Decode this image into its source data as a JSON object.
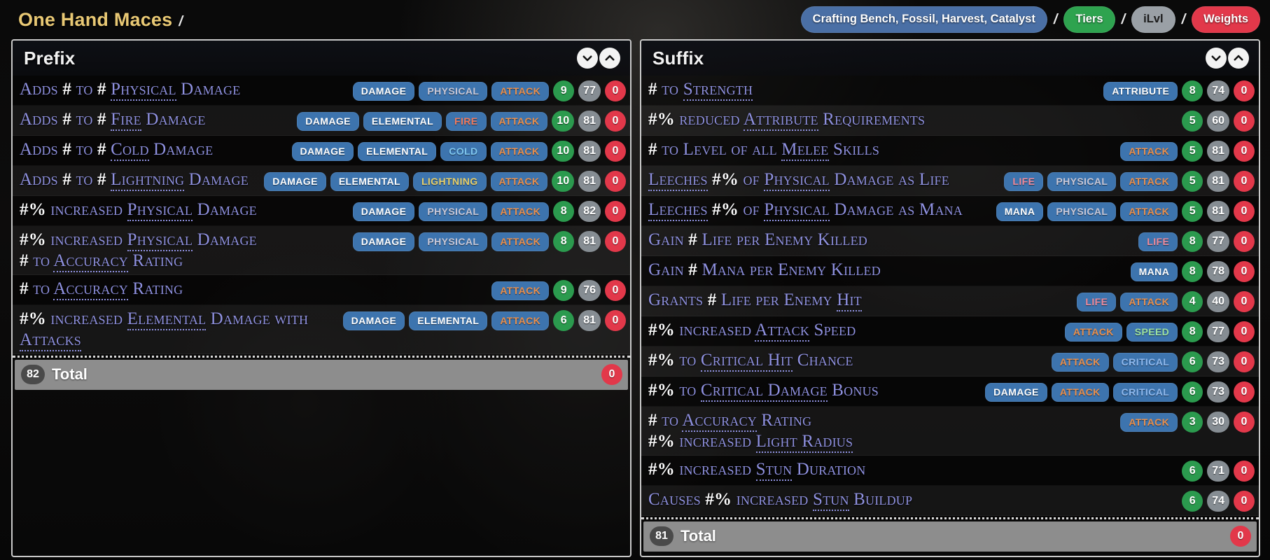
{
  "header": {
    "title": "One Hand Maces",
    "separator": "/",
    "nav": [
      {
        "label": "Crafting Bench, Fossil, Harvest, Catalyst",
        "color": "#4a6fa5",
        "style": "pill-blue"
      },
      {
        "label": "Tiers",
        "color": "#2ea34f",
        "style": "pill-green"
      },
      {
        "label": "iLvl",
        "color": "#9aa0a6",
        "style": "pill-gray"
      },
      {
        "label": "Weights",
        "color": "#e2384a",
        "style": "pill-red"
      }
    ]
  },
  "icons": {
    "collapse_all": "chevron-down-icon",
    "expand_all": "chevron-up-icon"
  },
  "prefix": {
    "title": "Prefix",
    "total_label": "Total",
    "total_count": "82",
    "total_weight": "0",
    "rows": [
      {
        "text_parts": [
          {
            "t": "Adds ",
            "k": false
          },
          {
            "t": "#",
            "k": "num"
          },
          {
            "t": " to ",
            "k": false
          },
          {
            "t": "#",
            "k": "num"
          },
          {
            "t": " ",
            "k": false
          },
          {
            "t": "Physical",
            "k": true
          },
          {
            "t": " Damage",
            "k": false
          }
        ],
        "plain_text": "Adds # to # Physical Damage",
        "tags": [
          {
            "label": "DAMAGE",
            "cls": "t-damage"
          },
          {
            "label": "PHYSICAL",
            "cls": "t-physical"
          },
          {
            "label": "ATTACK",
            "cls": "t-attack"
          }
        ],
        "tier": "9",
        "ilvl": "77",
        "weight": "0"
      },
      {
        "text_parts": [
          {
            "t": "Adds ",
            "k": false
          },
          {
            "t": "#",
            "k": "num"
          },
          {
            "t": " to ",
            "k": false
          },
          {
            "t": "#",
            "k": "num"
          },
          {
            "t": " ",
            "k": false
          },
          {
            "t": "Fire",
            "k": true
          },
          {
            "t": " Damage",
            "k": false
          }
        ],
        "plain_text": "Adds # to # Fire Damage",
        "tags": [
          {
            "label": "DAMAGE",
            "cls": "t-damage"
          },
          {
            "label": "ELEMENTAL",
            "cls": "t-elemental"
          },
          {
            "label": "FIRE",
            "cls": "t-fire"
          },
          {
            "label": "ATTACK",
            "cls": "t-attack"
          }
        ],
        "tier": "10",
        "ilvl": "81",
        "weight": "0"
      },
      {
        "text_parts": [
          {
            "t": "Adds ",
            "k": false
          },
          {
            "t": "#",
            "k": "num"
          },
          {
            "t": " to ",
            "k": false
          },
          {
            "t": "#",
            "k": "num"
          },
          {
            "t": " ",
            "k": false
          },
          {
            "t": "Cold",
            "k": true
          },
          {
            "t": " Damage",
            "k": false
          }
        ],
        "plain_text": "Adds # to # Cold Damage",
        "tags": [
          {
            "label": "DAMAGE",
            "cls": "t-damage"
          },
          {
            "label": "ELEMENTAL",
            "cls": "t-elemental"
          },
          {
            "label": "COLD",
            "cls": "t-cold"
          },
          {
            "label": "ATTACK",
            "cls": "t-attack"
          }
        ],
        "tier": "10",
        "ilvl": "81",
        "weight": "0"
      },
      {
        "text_parts": [
          {
            "t": "Adds ",
            "k": false
          },
          {
            "t": "#",
            "k": "num"
          },
          {
            "t": " to ",
            "k": false
          },
          {
            "t": "#",
            "k": "num"
          },
          {
            "t": " ",
            "k": false
          },
          {
            "t": "Lightning",
            "k": true
          },
          {
            "t": " Damage",
            "k": false
          }
        ],
        "plain_text": "Adds # to # Lightning Damage",
        "tags": [
          {
            "label": "DAMAGE",
            "cls": "t-damage"
          },
          {
            "label": "ELEMENTAL",
            "cls": "t-elemental"
          },
          {
            "label": "LIGHTNING",
            "cls": "t-lightning"
          },
          {
            "label": "ATTACK",
            "cls": "t-attack"
          }
        ],
        "tier": "10",
        "ilvl": "81",
        "weight": "0"
      },
      {
        "text_parts": [
          {
            "t": "#%",
            "k": "num"
          },
          {
            "t": " increased ",
            "k": false
          },
          {
            "t": "Physical",
            "k": true
          },
          {
            "t": " Damage",
            "k": false
          }
        ],
        "plain_text": "#% increased Physical Damage",
        "tags": [
          {
            "label": "DAMAGE",
            "cls": "t-damage"
          },
          {
            "label": "PHYSICAL",
            "cls": "t-physical"
          },
          {
            "label": "ATTACK",
            "cls": "t-attack"
          }
        ],
        "tier": "8",
        "ilvl": "82",
        "weight": "0"
      },
      {
        "text_parts": [
          {
            "t": "#%",
            "k": "num"
          },
          {
            "t": " increased ",
            "k": false
          },
          {
            "t": "Physical",
            "k": true
          },
          {
            "t": " Damage",
            "k": false
          },
          {
            "t": "\n",
            "k": "br"
          },
          {
            "t": "#",
            "k": "num"
          },
          {
            "t": " to ",
            "k": false
          },
          {
            "t": "Accuracy",
            "k": true
          },
          {
            "t": " Rating",
            "k": false
          }
        ],
        "plain_text": "#% increased Physical Damage # to Accuracy Rating",
        "tags": [
          {
            "label": "DAMAGE",
            "cls": "t-damage"
          },
          {
            "label": "PHYSICAL",
            "cls": "t-physical"
          },
          {
            "label": "ATTACK",
            "cls": "t-attack"
          }
        ],
        "tier": "8",
        "ilvl": "81",
        "weight": "0"
      },
      {
        "text_parts": [
          {
            "t": "#",
            "k": "num"
          },
          {
            "t": " to ",
            "k": false
          },
          {
            "t": "Accuracy",
            "k": true
          },
          {
            "t": " Rating",
            "k": false
          }
        ],
        "plain_text": "# to Accuracy Rating",
        "tags": [
          {
            "label": "ATTACK",
            "cls": "t-attack"
          }
        ],
        "tier": "9",
        "ilvl": "76",
        "weight": "0"
      },
      {
        "text_parts": [
          {
            "t": "#%",
            "k": "num"
          },
          {
            "t": " increased ",
            "k": false
          },
          {
            "t": "Elemental",
            "k": true
          },
          {
            "t": " Damage with ",
            "k": false
          },
          {
            "t": "Attacks",
            "k": true
          }
        ],
        "plain_text": "#% increased Elemental Damage with Attacks",
        "tags": [
          {
            "label": "DAMAGE",
            "cls": "t-damage"
          },
          {
            "label": "ELEMENTAL",
            "cls": "t-elemental"
          },
          {
            "label": "ATTACK",
            "cls": "t-attack"
          }
        ],
        "tier": "6",
        "ilvl": "81",
        "weight": "0"
      }
    ]
  },
  "suffix": {
    "title": "Suffix",
    "total_label": "Total",
    "total_count": "81",
    "total_weight": "0",
    "rows": [
      {
        "text_parts": [
          {
            "t": "#",
            "k": "num"
          },
          {
            "t": " to ",
            "k": false
          },
          {
            "t": "Strength",
            "k": true
          }
        ],
        "plain_text": "# to Strength",
        "tags": [
          {
            "label": "ATTRIBUTE",
            "cls": "t-attribute"
          }
        ],
        "tier": "8",
        "ilvl": "74",
        "weight": "0"
      },
      {
        "text_parts": [
          {
            "t": "#%",
            "k": "num"
          },
          {
            "t": " reduced ",
            "k": false
          },
          {
            "t": "Attribute",
            "k": true
          },
          {
            "t": " Requirements",
            "k": false
          }
        ],
        "plain_text": "#% reduced Attribute Requirements",
        "tags": [],
        "tier": "5",
        "ilvl": "60",
        "weight": "0"
      },
      {
        "text_parts": [
          {
            "t": "#",
            "k": "num"
          },
          {
            "t": " to Level of all ",
            "k": false
          },
          {
            "t": "Melee",
            "k": true
          },
          {
            "t": " Skills",
            "k": false
          }
        ],
        "plain_text": "# to Level of all Melee Skills",
        "tags": [
          {
            "label": "ATTACK",
            "cls": "t-attack"
          }
        ],
        "tier": "5",
        "ilvl": "81",
        "weight": "0"
      },
      {
        "text_parts": [
          {
            "t": "Leeches",
            "k": true
          },
          {
            "t": " ",
            "k": false
          },
          {
            "t": "#%",
            "k": "num"
          },
          {
            "t": " of ",
            "k": false
          },
          {
            "t": "Physical",
            "k": true
          },
          {
            "t": " Damage as Life",
            "k": false
          }
        ],
        "plain_text": "Leeches #% of Physical Damage as Life",
        "tags": [
          {
            "label": "LIFE",
            "cls": "t-life"
          },
          {
            "label": "PHYSICAL",
            "cls": "t-physical"
          },
          {
            "label": "ATTACK",
            "cls": "t-attack"
          }
        ],
        "tier": "5",
        "ilvl": "81",
        "weight": "0"
      },
      {
        "text_parts": [
          {
            "t": "Leeches",
            "k": true
          },
          {
            "t": " ",
            "k": false
          },
          {
            "t": "#%",
            "k": "num"
          },
          {
            "t": " of ",
            "k": false
          },
          {
            "t": "Physical",
            "k": true
          },
          {
            "t": " Damage as Mana",
            "k": false
          }
        ],
        "plain_text": "Leeches #% of Physical Damage as Mana",
        "tags": [
          {
            "label": "MANA",
            "cls": "t-mana"
          },
          {
            "label": "PHYSICAL",
            "cls": "t-physical"
          },
          {
            "label": "ATTACK",
            "cls": "t-attack"
          }
        ],
        "tier": "5",
        "ilvl": "81",
        "weight": "0"
      },
      {
        "text_parts": [
          {
            "t": "Gain ",
            "k": false
          },
          {
            "t": "#",
            "k": "num"
          },
          {
            "t": " Life per Enemy Killed",
            "k": false
          }
        ],
        "plain_text": "Gain # Life per Enemy Killed",
        "tags": [
          {
            "label": "LIFE",
            "cls": "t-life"
          }
        ],
        "tier": "8",
        "ilvl": "77",
        "weight": "0"
      },
      {
        "text_parts": [
          {
            "t": "Gain ",
            "k": false
          },
          {
            "t": "#",
            "k": "num"
          },
          {
            "t": " Mana per Enemy Killed",
            "k": false
          }
        ],
        "plain_text": "Gain # Mana per Enemy Killed",
        "tags": [
          {
            "label": "MANA",
            "cls": "t-mana"
          }
        ],
        "tier": "8",
        "ilvl": "78",
        "weight": "0"
      },
      {
        "text_parts": [
          {
            "t": "Grants ",
            "k": false
          },
          {
            "t": "#",
            "k": "num"
          },
          {
            "t": " Life per Enemy ",
            "k": false
          },
          {
            "t": "Hit",
            "k": true
          }
        ],
        "plain_text": "Grants # Life per Enemy Hit",
        "tags": [
          {
            "label": "LIFE",
            "cls": "t-life"
          },
          {
            "label": "ATTACK",
            "cls": "t-attack"
          }
        ],
        "tier": "4",
        "ilvl": "40",
        "weight": "0"
      },
      {
        "text_parts": [
          {
            "t": "#%",
            "k": "num"
          },
          {
            "t": " increased ",
            "k": false
          },
          {
            "t": "Attack",
            "k": true
          },
          {
            "t": " Speed",
            "k": false
          }
        ],
        "plain_text": "#% increased Attack Speed",
        "tags": [
          {
            "label": "ATTACK",
            "cls": "t-attack"
          },
          {
            "label": "SPEED",
            "cls": "t-speed"
          }
        ],
        "tier": "8",
        "ilvl": "77",
        "weight": "0"
      },
      {
        "text_parts": [
          {
            "t": "#%",
            "k": "num"
          },
          {
            "t": " to ",
            "k": false
          },
          {
            "t": "Critical Hit",
            "k": true
          },
          {
            "t": " Chance",
            "k": false
          }
        ],
        "plain_text": "#% to Critical Hit Chance",
        "tags": [
          {
            "label": "ATTACK",
            "cls": "t-attack"
          },
          {
            "label": "CRITICAL",
            "cls": "t-critical"
          }
        ],
        "tier": "6",
        "ilvl": "73",
        "weight": "0"
      },
      {
        "text_parts": [
          {
            "t": "#%",
            "k": "num"
          },
          {
            "t": " to ",
            "k": false
          },
          {
            "t": "Critical Damage",
            "k": true
          },
          {
            "t": " Bonus",
            "k": false
          }
        ],
        "plain_text": "#% to Critical Damage Bonus",
        "tags": [
          {
            "label": "DAMAGE",
            "cls": "t-damage"
          },
          {
            "label": "ATTACK",
            "cls": "t-attack"
          },
          {
            "label": "CRITICAL",
            "cls": "t-critical"
          }
        ],
        "tier": "6",
        "ilvl": "73",
        "weight": "0"
      },
      {
        "text_parts": [
          {
            "t": "#",
            "k": "num"
          },
          {
            "t": " to ",
            "k": false
          },
          {
            "t": "Accuracy",
            "k": true
          },
          {
            "t": " Rating",
            "k": false
          },
          {
            "t": "\n",
            "k": "br"
          },
          {
            "t": "#%",
            "k": "num"
          },
          {
            "t": " increased ",
            "k": false
          },
          {
            "t": "Light Radius",
            "k": true
          }
        ],
        "plain_text": "# to Accuracy Rating #% increased Light Radius",
        "tags": [
          {
            "label": "ATTACK",
            "cls": "t-attack"
          }
        ],
        "tier": "3",
        "ilvl": "30",
        "weight": "0"
      },
      {
        "text_parts": [
          {
            "t": "#%",
            "k": "num"
          },
          {
            "t": " increased ",
            "k": false
          },
          {
            "t": "Stun",
            "k": true
          },
          {
            "t": " Duration",
            "k": false
          }
        ],
        "plain_text": "#% increased Stun Duration",
        "tags": [],
        "tier": "6",
        "ilvl": "71",
        "weight": "0"
      },
      {
        "text_parts": [
          {
            "t": "Causes ",
            "k": false
          },
          {
            "t": "#%",
            "k": "num"
          },
          {
            "t": " increased ",
            "k": false
          },
          {
            "t": "Stun",
            "k": true
          },
          {
            "t": " Buildup",
            "k": false
          }
        ],
        "plain_text": "Causes #% increased Stun Buildup",
        "tags": [],
        "tier": "6",
        "ilvl": "74",
        "weight": "0"
      }
    ]
  }
}
